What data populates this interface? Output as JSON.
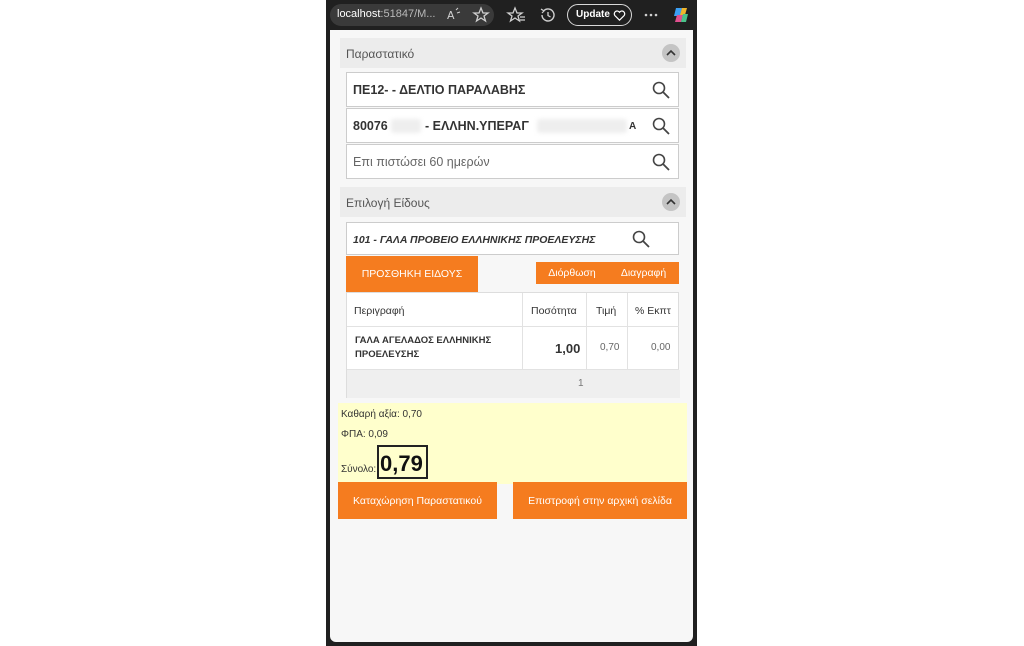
{
  "browser": {
    "address_host": "localhost",
    "address_rest": ":51847/M...",
    "update_label": "Update",
    "icons": [
      "read-aloud-icon",
      "favorite-star-icon",
      "favorites-icon",
      "history-icon",
      "more-icon",
      "copilot-icon"
    ]
  },
  "document_section": {
    "title": "Παραστατικό",
    "document_type": "ΠΕ12- - ΔΕΛΤΙΟ ΠΑΡΑΛΑΒΗΣ",
    "supplier_code": "80076",
    "supplier_name": "- ΕΛΛΗΝ.ΥΠΕΡΑΓ",
    "supplier_suffix": "Α",
    "payment_terms": "Επι πιστώσει 60 ημερών"
  },
  "item_section": {
    "title": "Επιλογή Είδους",
    "selected_item": "101 - ΓΑΛΑ ΠΡΟΒΕΙΟ ΕΛΛΗΝΙΚΗΣ ΠΡΟΕΛΕΥΣΗΣ",
    "add_button": "ΠΡΟΣΘΗΚΗ ΕΙΔΟΥΣ",
    "edit_button": "Διόρθωση",
    "delete_button": "Διαγραφή"
  },
  "table": {
    "headers": [
      "Περιγραφή",
      "Ποσότητα",
      "Τιμή",
      "% Εκπτ"
    ],
    "rows": [
      {
        "description_line1": "ΓΑΛΑ ΑΓΕΛΑΔΟΣ ΕΛΛΗΝΙΚΗΣ",
        "description_line2": "ΠΡΟΕΛΕΥΣΗΣ",
        "quantity": "1,00",
        "price": "0,70",
        "discount": "0,00"
      }
    ],
    "page": "1"
  },
  "totals": {
    "net_value": "Καθαρή αξία: 0,70",
    "vat": "ΦΠΑ: 0,09",
    "total_label": "Σύνολο:",
    "total_value": "0,79",
    "background_color": "#ffffcc"
  },
  "actions": {
    "submit_button": "Καταχώρηση Παραστατικού",
    "back_button": "Επιστροφή στην αρχική σελίδα",
    "accent_color": "#f57c1f"
  }
}
